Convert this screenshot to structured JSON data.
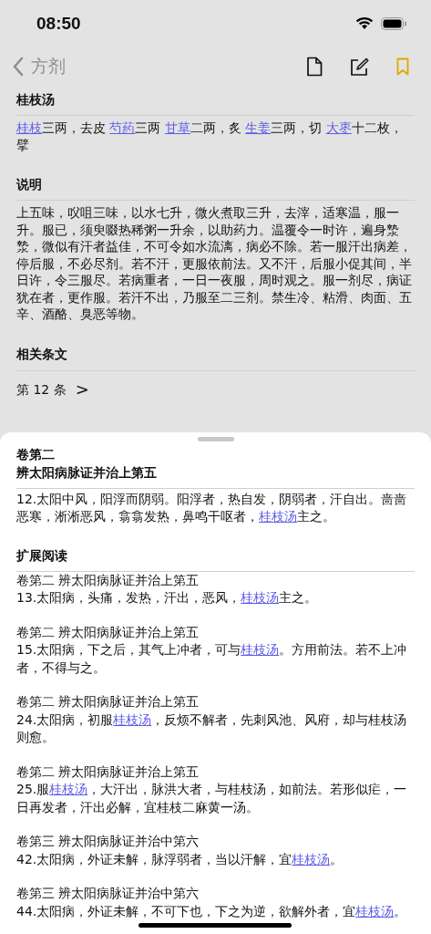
{
  "status_bar": {
    "time": "08:50"
  },
  "nav": {
    "back_label": "方剂",
    "bookmarked": true
  },
  "sections": [
    {
      "heading": "桂枝汤",
      "paragraphs": [
        [
          {
            "text": "桂枝",
            "link": true
          },
          {
            "text": "三两，去皮 ",
            "link": false
          },
          {
            "text": "芍药",
            "link": true
          },
          {
            "text": "三两 ",
            "link": false
          },
          {
            "text": "甘草",
            "link": true
          },
          {
            "text": "二两，炙 ",
            "link": false
          },
          {
            "text": "生姜",
            "link": true
          },
          {
            "text": "三两，切 ",
            "link": false
          },
          {
            "text": "大枣",
            "link": true
          },
          {
            "text": "十二枚，擘",
            "link": false
          }
        ]
      ]
    },
    {
      "heading": "说明",
      "paragraphs": [
        [
          {
            "text": "上五味，㕮咀三味，以水七升，微火煮取三升，去滓，适寒温，服一升。服已，须臾啜热稀粥一升余，以助药力。温覆令一时许，遍身漐漐，微似有汗者益佳，不可令如水流漓，病必不除。若一服汗出病差，停后服，不必尽剂。若不汗，更服依前法。又不汗，后服小促其间，半日许，令三服尽。若病重者，一日一夜服，周时观之。服一剂尽，病证犹在者，更作服。若汗不出，乃服至二三剂。禁生冷、粘滑、肉面、五辛、酒酪、臭恶等物。",
            "link": false
          }
        ]
      ]
    }
  ],
  "related": {
    "heading": "相关条文",
    "link": "第 12 条",
    "chevron": ">"
  },
  "sheet": {
    "volume": "卷第二",
    "chapter": "辨太阳病脉证并治上第五",
    "clause": [
      {
        "text": "12.太阳中风，阳浮而阴弱。阳浮者，热自发，阴弱者，汗自出。啬啬恶寒，淅淅恶风，翕翕发热，鼻鸣干呕者，",
        "link": false
      },
      {
        "text": "桂枝汤",
        "link": true
      },
      {
        "text": "主之。",
        "link": false
      }
    ],
    "extended_heading": "扩展阅读",
    "entries": [
      {
        "source": "卷第二 辨太阳病脉证并治上第五",
        "text": [
          {
            "text": "13.太阳病，头痛，发热，汗出，恶风，",
            "link": false
          },
          {
            "text": "桂枝汤",
            "link": true
          },
          {
            "text": "主之。",
            "link": false
          }
        ]
      },
      {
        "source": "卷第二 辨太阳病脉证并治上第五",
        "text": [
          {
            "text": "15.太阳病，下之后，其气上冲者，可与",
            "link": false
          },
          {
            "text": "桂枝汤",
            "link": true
          },
          {
            "text": "。方用前法。若不上冲者，不得与之。",
            "link": false
          }
        ]
      },
      {
        "source": "卷第二 辨太阳病脉证并治上第五",
        "text": [
          {
            "text": "24.太阳病，初服",
            "link": false
          },
          {
            "text": "桂枝汤",
            "link": true
          },
          {
            "text": "，反烦不解者，先刺风池、风府，却与桂枝汤则愈。",
            "link": false
          }
        ]
      },
      {
        "source": "卷第二 辨太阳病脉证并治上第五",
        "text": [
          {
            "text": "25.服",
            "link": false
          },
          {
            "text": "桂枝汤",
            "link": true
          },
          {
            "text": "，大汗出，脉洪大者，与桂枝汤，如前法。若形似疟，一日再发者，汗出必解，宜桂枝二麻黄一汤。",
            "link": false
          }
        ]
      },
      {
        "source": "卷第三 辨太阳病脉证并治中第六",
        "text": [
          {
            "text": "42.太阳病，外证未解，脉浮弱者，当以汗解，宜",
            "link": false
          },
          {
            "text": "桂枝汤",
            "link": true
          },
          {
            "text": "。",
            "link": false
          }
        ]
      },
      {
        "source": "卷第三 辨太阳病脉证并治中第六",
        "text": [
          {
            "text": "44.太阳病，外证未解，不可下也，下之为逆，欲解外者，宜",
            "link": false
          },
          {
            "text": "桂枝汤",
            "link": true
          },
          {
            "text": "。",
            "link": false
          }
        ]
      }
    ]
  }
}
